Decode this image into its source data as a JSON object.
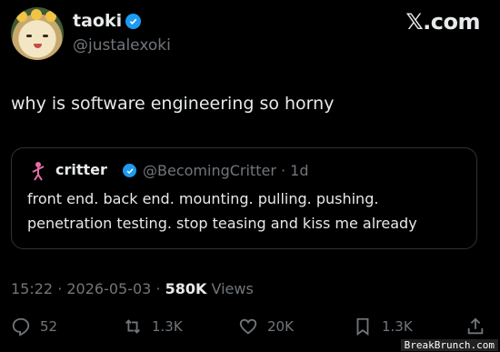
{
  "author": {
    "display_name": "taoki",
    "handle": "@justalexoki",
    "avatar_icon": "anime-avatar-icon"
  },
  "brand": {
    "label": "𝕏.com"
  },
  "tweet": {
    "text": "why is software engineering so horny"
  },
  "quoted": {
    "name": "critter",
    "handle_time": "@BecomingCritter · 1d",
    "text": "front end. back end. mounting. pulling. pushing. penetration testing. stop teasing and kiss me already"
  },
  "meta": {
    "timestamp": "15:22 · 2026-05-03 · ",
    "views_count": "580K",
    "views_label": " Views"
  },
  "actions": {
    "replies": "52",
    "reposts": "1.3K",
    "likes": "20K",
    "bookmarks": "1.3K"
  },
  "watermark": {
    "text": "BreakBrunch.com"
  },
  "colors": {
    "verified": "#1d9bf0",
    "muted": "#71767b",
    "text": "#e7e9ea",
    "background": "#000000"
  }
}
